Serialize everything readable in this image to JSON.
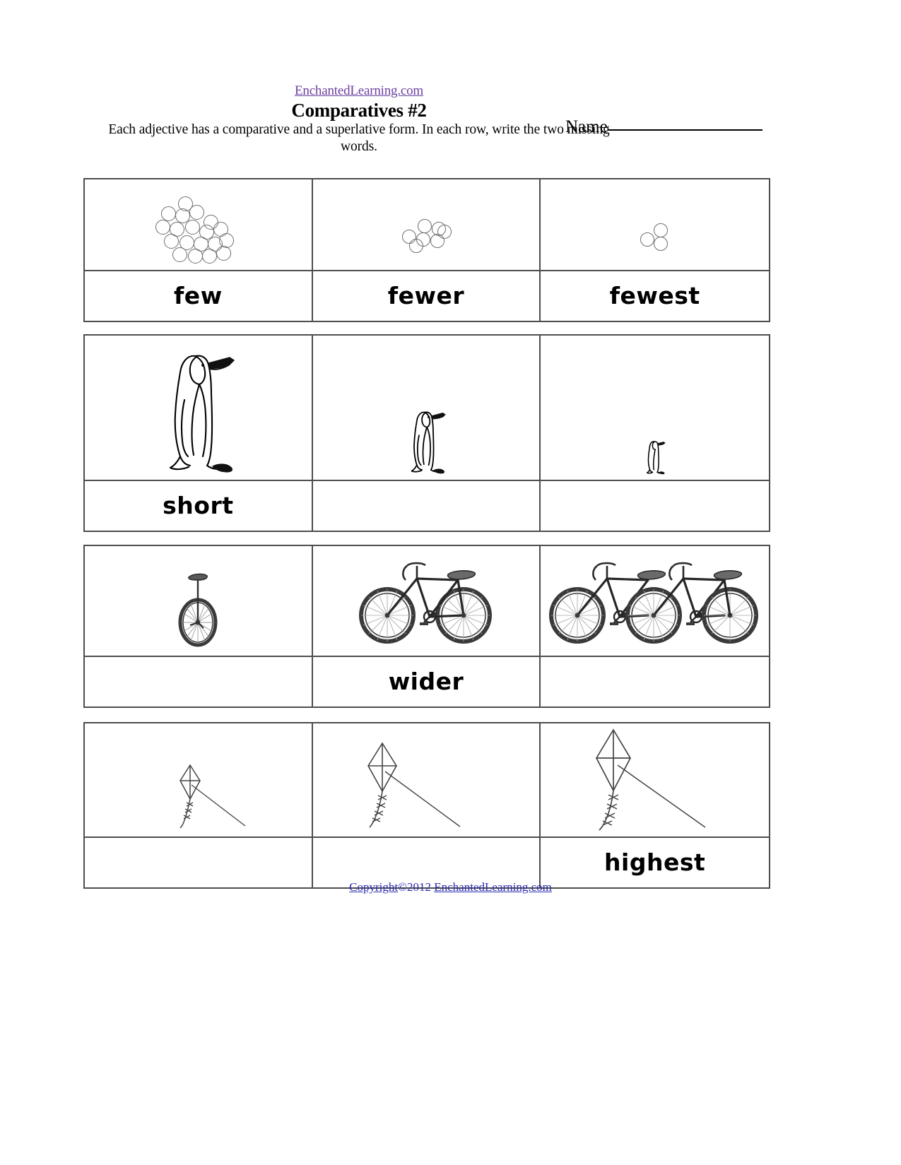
{
  "header": {
    "site_link": "EnchantedLearning.com",
    "title": "Comparatives #2",
    "instructions": "Each adjective has a comparative and a superlative form. In each row, write the two missing words.",
    "name_label": "Name"
  },
  "footer": {
    "copyright_word": "Copyright",
    "copyright_mid": "©2012",
    "copyright_site": "EnchantedLearning.com"
  },
  "colors": {
    "link_purple": "#6b3fa0",
    "footer_blue": "#2b2bb5",
    "border_gray": "#4d4d4d",
    "ink_black": "#000000",
    "circle_gray": "#6e6e6e"
  },
  "rows": [
    {
      "id": "few",
      "adjective_set": "few",
      "picture_kind": "circle-cluster",
      "cells": [
        {
          "icon": "circle-cluster-many-icon",
          "count": 19,
          "word": "few",
          "filled": true
        },
        {
          "icon": "circle-cluster-some-icon",
          "count": 7,
          "word": "fewer",
          "filled": true
        },
        {
          "icon": "circle-cluster-fewest-icon",
          "count": 3,
          "word": "fewest",
          "filled": true
        }
      ]
    },
    {
      "id": "short",
      "adjective_set": "short",
      "picture_kind": "penguin",
      "cells": [
        {
          "icon": "penguin-large-icon",
          "scale": 1.0,
          "word": "short",
          "filled": true
        },
        {
          "icon": "penguin-medium-icon",
          "scale": 0.52,
          "word": "",
          "filled": false
        },
        {
          "icon": "penguin-small-icon",
          "scale": 0.27,
          "word": "",
          "filled": false
        }
      ]
    },
    {
      "id": "wide",
      "adjective_set": "wide",
      "picture_kind": "cycle",
      "cells": [
        {
          "icon": "unicycle-icon",
          "wheels": 1,
          "word": "",
          "filled": false
        },
        {
          "icon": "bicycle-icon",
          "wheels": 2,
          "word": "wider",
          "filled": true
        },
        {
          "icon": "tricycle-row-icon",
          "wheels": 3,
          "word": "",
          "filled": false
        }
      ]
    },
    {
      "id": "high",
      "adjective_set": "high",
      "picture_kind": "kite",
      "cells": [
        {
          "icon": "kite-low-icon",
          "scale": 0.55,
          "word": "",
          "filled": false
        },
        {
          "icon": "kite-mid-icon",
          "scale": 0.78,
          "word": "",
          "filled": false
        },
        {
          "icon": "kite-high-icon",
          "scale": 1.0,
          "word": "highest",
          "filled": true
        }
      ]
    }
  ]
}
